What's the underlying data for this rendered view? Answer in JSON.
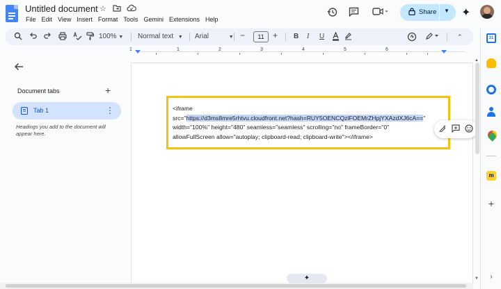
{
  "app": {
    "doc_title": "Untitled document",
    "menus": [
      "File",
      "Edit",
      "View",
      "Insert",
      "Format",
      "Tools",
      "Gemini",
      "Extensions",
      "Help"
    ],
    "share_label": "Share"
  },
  "toolbar": {
    "zoom": "100%",
    "style": "Normal text",
    "font": "Arial",
    "font_size": "11",
    "bold": "B",
    "italic": "I",
    "underline": "U"
  },
  "ruler": {
    "numbers": [
      "1",
      "1",
      "2",
      "3",
      "4",
      "5",
      "6"
    ]
  },
  "left_pane": {
    "heading": "Document tabs",
    "tab_label": "Tab 1",
    "hint": "Headings you add to the document will appear here."
  },
  "document": {
    "line1": "<iframe",
    "line2_prefix": "src=\"",
    "line2_url": "https://d3ms8mre5rhtvu.cloudfront.net?hash=RUY5OENCQzlFOEMrZHpjYXAzdXJ6cA==",
    "line2_suffix": "\"",
    "line3": "width=\"100%\" height=\"480\" seamless=\"seamless\" scrolling=\"no\" frameBorder=\"0\"",
    "line4": "allowFullScreen allow=\"autoplay; clipboard-read; clipboard-write\"></iframe>"
  },
  "side_panel": {
    "calendar_day": "31"
  },
  "colors": {
    "accent": "#0b57d0",
    "share_bg": "#c2e7ff",
    "highlight_border": "#f4c20d",
    "selection": "#c4d7f8"
  },
  "icons": [
    "star-icon",
    "move-folder-icon",
    "cloud-status-icon",
    "history-icon",
    "comment-icon",
    "video-call-icon",
    "lock-icon",
    "gemini-star-icon",
    "search-icon",
    "undo-icon",
    "redo-icon",
    "print-icon",
    "spellcheck-icon",
    "paint-format-icon",
    "text-color-icon",
    "highlight-icon",
    "edit-mode-icon",
    "back-arrow-icon",
    "add-icon",
    "document-icon",
    "kebab-icon"
  ]
}
